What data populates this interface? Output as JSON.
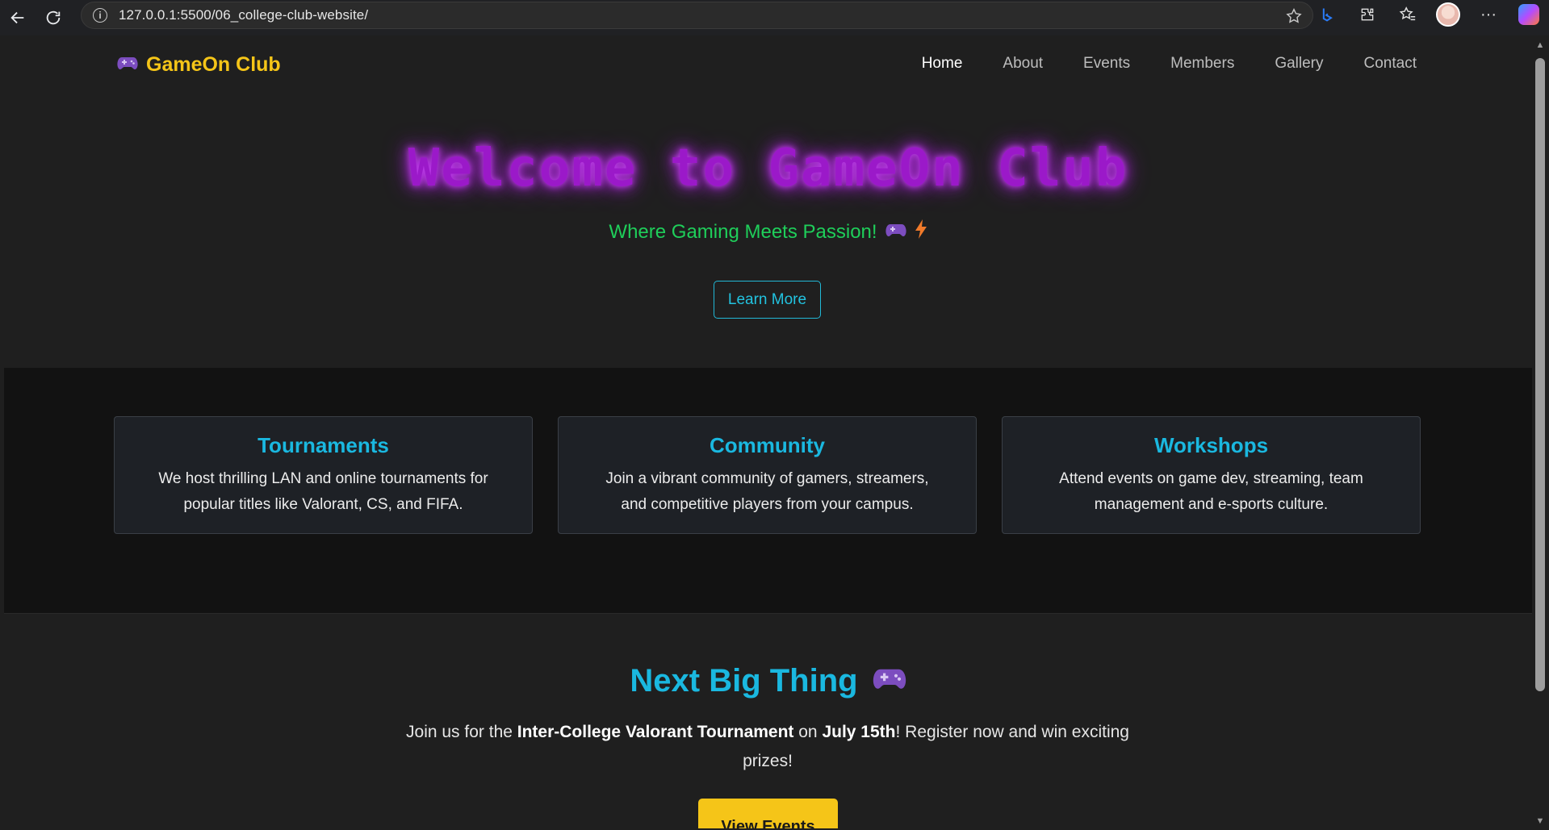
{
  "browser": {
    "url": "127.0.0.1:5500/06_college-club-website/"
  },
  "nav": {
    "brand": "GameOn Club",
    "links": [
      "Home",
      "About",
      "Events",
      "Members",
      "Gallery",
      "Contact"
    ],
    "active": "Home"
  },
  "hero": {
    "title": "Welcome to GameOn Club",
    "subtitle": "Where Gaming Meets Passion!",
    "button": "Learn More"
  },
  "features": [
    {
      "title": "Tournaments",
      "text": "We host thrilling LAN and online tournaments for popular titles like Valorant, CS, and FIFA."
    },
    {
      "title": "Community",
      "text": "Join a vibrant community of gamers, streamers, and competitive players from your campus."
    },
    {
      "title": "Workshops",
      "text": "Attend events on game dev, streaming, team management and e-sports culture."
    }
  ],
  "next_big_thing": {
    "title": "Next Big Thing",
    "text_before": "Join us for the ",
    "event": "Inter-College Valorant Tournament",
    "text_mid": " on ",
    "date": "July 15th",
    "text_after": "! Register now and win exciting prizes!",
    "button": "View Events"
  },
  "colors": {
    "brand": "#f5c518",
    "accent": "#1ab8e0",
    "hero_title": "#9b19c9",
    "subtitle": "#1fce5a"
  },
  "icons": [
    "back-arrow-icon",
    "refresh-icon",
    "info-icon",
    "star-icon",
    "gamepad-icon",
    "lightning-icon"
  ]
}
